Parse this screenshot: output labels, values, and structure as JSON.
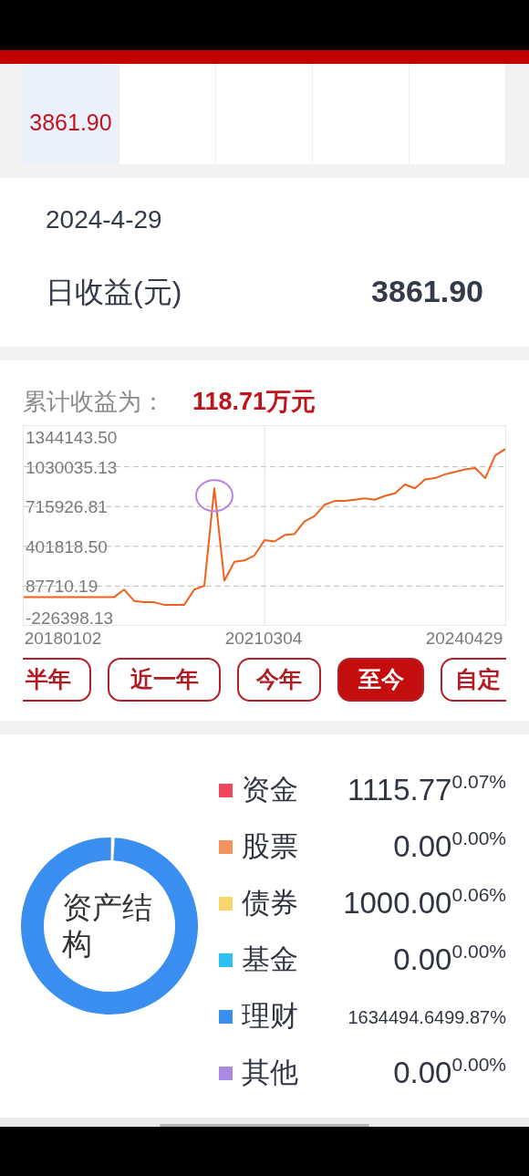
{
  "calendar": {
    "cells": [
      {
        "selected": true,
        "value": "3861.90"
      },
      {
        "selected": false
      },
      {
        "selected": false
      },
      {
        "selected": false
      },
      {
        "selected": false
      }
    ]
  },
  "daily": {
    "date": "2024-4-29",
    "label": "日收益(元)",
    "value": "3861.90"
  },
  "cumulative": {
    "label": "累计收益为：",
    "value": "118.71万元",
    "chart_data": {
      "type": "line",
      "grid": true,
      "categories": [
        null,
        null,
        null,
        null,
        "20180102",
        null,
        null,
        null,
        null,
        null,
        null,
        null,
        null,
        null,
        null,
        null,
        null,
        null,
        null,
        null,
        null,
        null,
        null,
        null,
        "20210304",
        null,
        null,
        null,
        null,
        null,
        null,
        null,
        null,
        null,
        null,
        null,
        null,
        null,
        null,
        null,
        null,
        null,
        null,
        null,
        "20240429",
        null,
        null,
        null,
        null
      ],
      "ylim": [
        -226398.13,
        1344143.5
      ],
      "yticks": [
        {
          "value": 1344143.5,
          "label": "1344143.50"
        },
        {
          "value": 1030035.13,
          "label": "1030035.13"
        },
        {
          "value": 715926.81,
          "label": "715926.81"
        },
        {
          "value": 401818.5,
          "label": "401818.50"
        },
        {
          "value": 87710.19,
          "label": "87710.19"
        },
        {
          "value": -226398.13,
          "label": "-226398.13"
        }
      ],
      "series": [
        {
          "color": "#f0601a",
          "values": [
            0,
            0,
            0,
            0,
            0,
            0,
            0,
            0,
            0,
            0,
            60000,
            -30000,
            -40000,
            -40000,
            -60000,
            -60000,
            -60000,
            60000,
            90000,
            860000,
            130000,
            280000,
            290000,
            330000,
            450000,
            440000,
            490000,
            500000,
            600000,
            640000,
            730000,
            760000,
            760000,
            770000,
            780000,
            770000,
            800000,
            820000,
            890000,
            860000,
            930000,
            940000,
            970000,
            990000,
            1010000,
            1020000,
            940000,
            1120000,
            1170000
          ]
        }
      ]
    },
    "ranges": [
      {
        "label": "半年",
        "selected": false
      },
      {
        "label": "近一年",
        "selected": false
      },
      {
        "label": "今年",
        "selected": false
      },
      {
        "label": "至今",
        "selected": true
      },
      {
        "label": "自定",
        "selected": false
      }
    ]
  },
  "assets": {
    "title": "资产结构",
    "chart_data": {
      "type": "donut",
      "values": [
        0.07,
        0,
        0.06,
        0,
        99.87,
        0
      ]
    },
    "items": [
      {
        "label": "资金",
        "amount": "1115.77",
        "percent": "0.07%",
        "color": "#f0475a"
      },
      {
        "label": "股票",
        "amount": "0.00",
        "percent": "0.00%",
        "color": "#f4935c"
      },
      {
        "label": "债券",
        "amount": "1000.00",
        "percent": "0.06%",
        "color": "#f9d56e"
      },
      {
        "label": "基金",
        "amount": "0.00",
        "percent": "0.00%",
        "color": "#2ec0f0"
      },
      {
        "label": "理财",
        "amount": "1634494.64",
        "percent": "99.87%",
        "color": "#3a8ef0"
      },
      {
        "label": "其他",
        "amount": "0.00",
        "percent": "0.00%",
        "color": "#a98be6"
      }
    ]
  }
}
